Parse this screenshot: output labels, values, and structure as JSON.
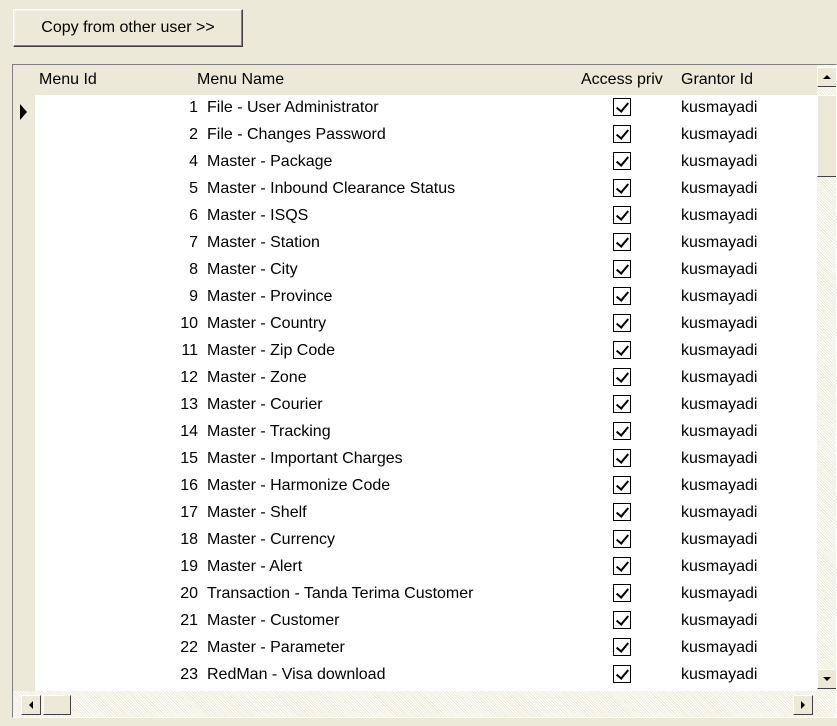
{
  "toolbar": {
    "copy_label": "Copy from other user >>"
  },
  "grid": {
    "columns": {
      "menu_id": "Menu Id",
      "menu_name": "Menu Name",
      "access_priv": "Access priv",
      "grantor_id": "Grantor Id"
    },
    "rows": [
      {
        "id": "1",
        "name": "File - User Administrator",
        "access": true,
        "grantor": "kusmayadi"
      },
      {
        "id": "2",
        "name": "File - Changes Password",
        "access": true,
        "grantor": "kusmayadi"
      },
      {
        "id": "4",
        "name": "Master - Package",
        "access": true,
        "grantor": "kusmayadi"
      },
      {
        "id": "5",
        "name": "Master - Inbound Clearance Status",
        "access": true,
        "grantor": "kusmayadi"
      },
      {
        "id": "6",
        "name": "Master - ISQS",
        "access": true,
        "grantor": "kusmayadi"
      },
      {
        "id": "7",
        "name": "Master - Station",
        "access": true,
        "grantor": "kusmayadi"
      },
      {
        "id": "8",
        "name": "Master - City",
        "access": true,
        "grantor": "kusmayadi"
      },
      {
        "id": "9",
        "name": "Master - Province",
        "access": true,
        "grantor": "kusmayadi"
      },
      {
        "id": "10",
        "name": "Master - Country",
        "access": true,
        "grantor": "kusmayadi"
      },
      {
        "id": "11",
        "name": "Master - Zip Code",
        "access": true,
        "grantor": "kusmayadi"
      },
      {
        "id": "12",
        "name": "Master - Zone",
        "access": true,
        "grantor": "kusmayadi"
      },
      {
        "id": "13",
        "name": "Master - Courier",
        "access": true,
        "grantor": "kusmayadi"
      },
      {
        "id": "14",
        "name": "Master - Tracking",
        "access": true,
        "grantor": "kusmayadi"
      },
      {
        "id": "15",
        "name": "Master - Important Charges",
        "access": true,
        "grantor": "kusmayadi"
      },
      {
        "id": "16",
        "name": "Master - Harmonize Code",
        "access": true,
        "grantor": "kusmayadi"
      },
      {
        "id": "17",
        "name": "Master - Shelf",
        "access": true,
        "grantor": "kusmayadi"
      },
      {
        "id": "18",
        "name": "Master - Currency",
        "access": true,
        "grantor": "kusmayadi"
      },
      {
        "id": "19",
        "name": "Master - Alert",
        "access": true,
        "grantor": "kusmayadi"
      },
      {
        "id": "20",
        "name": "Transaction - Tanda Terima Customer",
        "access": true,
        "grantor": "kusmayadi"
      },
      {
        "id": "21",
        "name": "Master - Customer",
        "access": true,
        "grantor": "kusmayadi"
      },
      {
        "id": "22",
        "name": "Master - Parameter",
        "access": true,
        "grantor": "kusmayadi"
      },
      {
        "id": "23",
        "name": "RedMan - Visa download",
        "access": true,
        "grantor": "kusmayadi"
      }
    ]
  }
}
